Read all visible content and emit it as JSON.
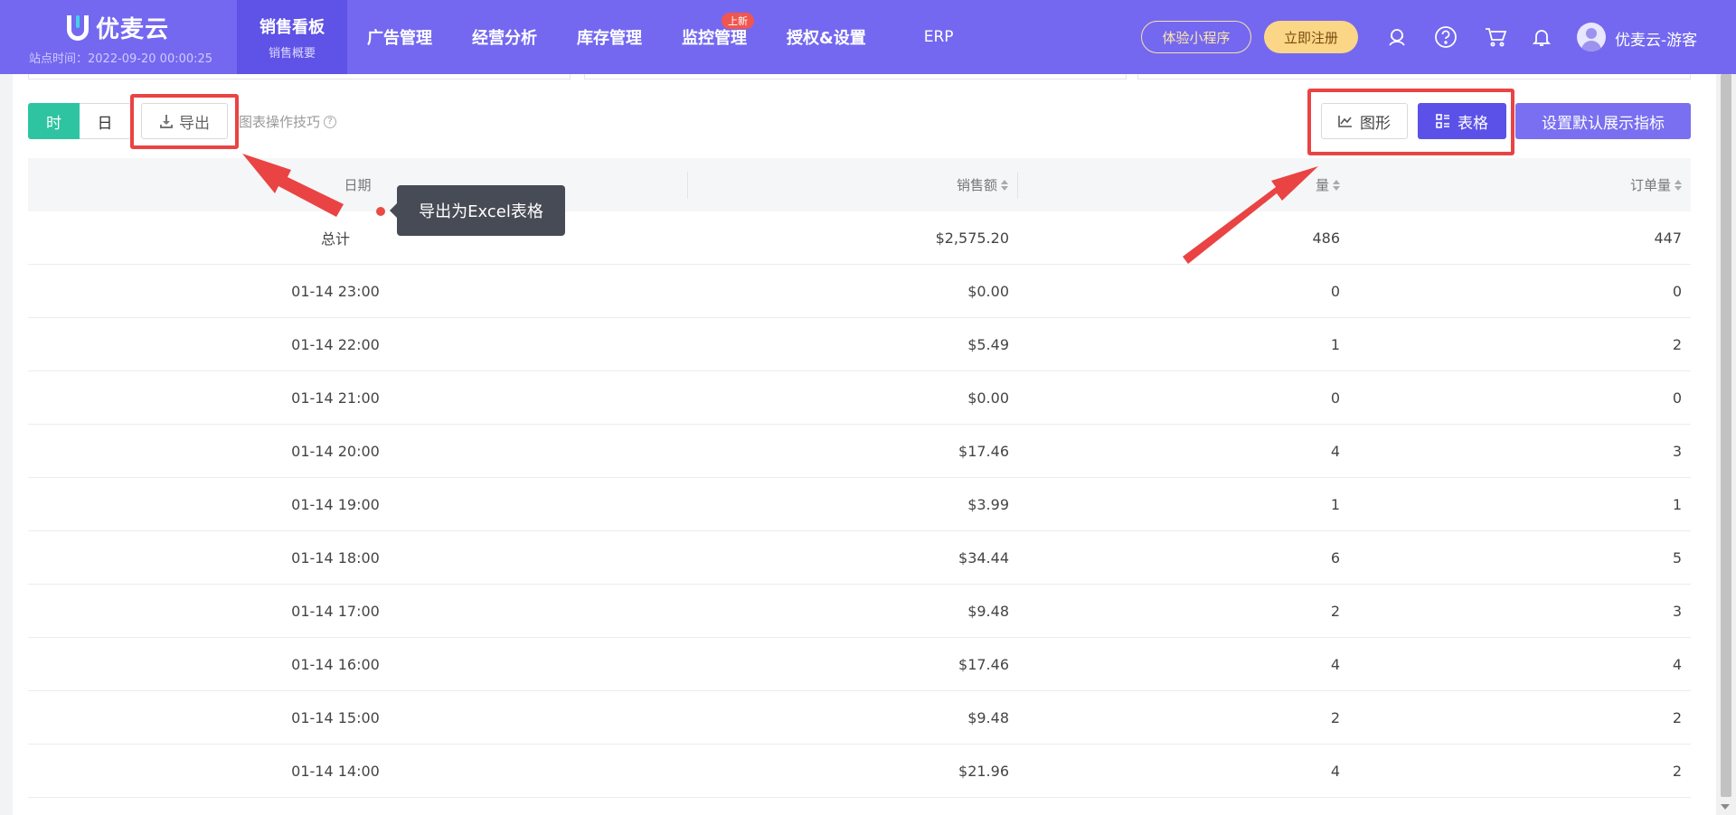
{
  "app": {
    "logo_text": "优麦云",
    "site_time": "站点时间：2022-09-20 00:00:25"
  },
  "nav": {
    "items": [
      {
        "label": "销售看板",
        "sub": "销售概要",
        "active": true
      },
      {
        "label": "广告管理"
      },
      {
        "label": "经营分析"
      },
      {
        "label": "库存管理"
      },
      {
        "label": "监控管理",
        "badge": "上新"
      },
      {
        "label": "授权&设置"
      },
      {
        "label": "ERP"
      }
    ],
    "mini_program_label": "体验小程序",
    "register_label": "立即注册",
    "user_name": "优麦云-游客",
    "icons": [
      "support-icon",
      "help-icon",
      "cart-icon",
      "bell-icon",
      "avatar-icon"
    ]
  },
  "toolbar": {
    "hour_label": "时",
    "day_label": "日",
    "export_label": "导出",
    "tips_label": "图表操作技巧",
    "graph_label": "图形",
    "table_label": "表格",
    "default_metrics_label": "设置默认展示指标"
  },
  "tooltip": {
    "text": "导出为Excel表格"
  },
  "table": {
    "headers": {
      "date": "日期",
      "sales": "销售额",
      "units": "量",
      "orders": "订单量"
    },
    "rows": [
      {
        "date": "总计",
        "sales": "$2,575.20",
        "units": "486",
        "orders": "447"
      },
      {
        "date": "01-14 23:00",
        "sales": "$0.00",
        "units": "0",
        "orders": "0"
      },
      {
        "date": "01-14 22:00",
        "sales": "$5.49",
        "units": "1",
        "orders": "2"
      },
      {
        "date": "01-14 21:00",
        "sales": "$0.00",
        "units": "0",
        "orders": "0"
      },
      {
        "date": "01-14 20:00",
        "sales": "$17.46",
        "units": "4",
        "orders": "3"
      },
      {
        "date": "01-14 19:00",
        "sales": "$3.99",
        "units": "1",
        "orders": "1"
      },
      {
        "date": "01-14 18:00",
        "sales": "$34.44",
        "units": "6",
        "orders": "5"
      },
      {
        "date": "01-14 17:00",
        "sales": "$9.48",
        "units": "2",
        "orders": "3"
      },
      {
        "date": "01-14 16:00",
        "sales": "$17.46",
        "units": "4",
        "orders": "4"
      },
      {
        "date": "01-14 15:00",
        "sales": "$9.48",
        "units": "2",
        "orders": "2"
      },
      {
        "date": "01-14 14:00",
        "sales": "$21.96",
        "units": "4",
        "orders": "2"
      }
    ]
  },
  "colors": {
    "nav_bg": "#7468f0",
    "nav_active": "#5f52e6",
    "toggle_active": "#2ec4a1",
    "table_btn": "#5b51e8",
    "annotation": "#ea4343"
  }
}
